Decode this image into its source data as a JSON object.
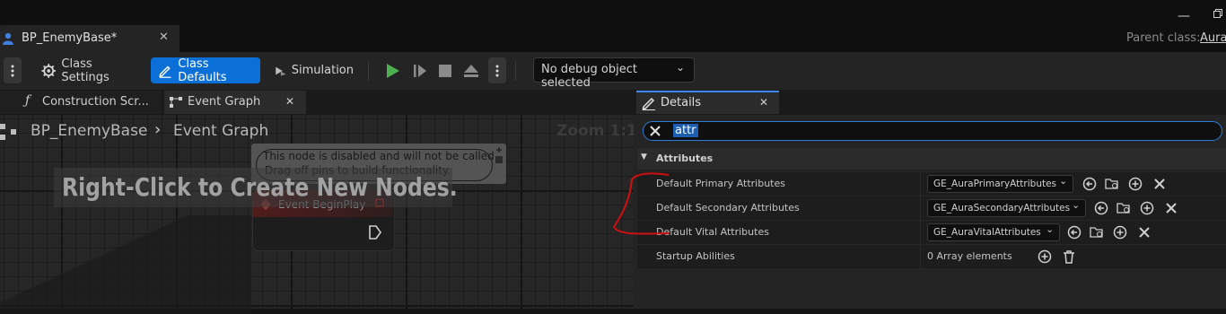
{
  "window": {
    "document_tab": "BP_EnemyBase*",
    "parent_class_label": "Parent class:",
    "parent_class_value": "Aura"
  },
  "toolbar": {
    "class_settings": "Class Settings",
    "class_defaults": "Class Defaults",
    "simulation": "Simulation",
    "debug_object": "No debug object selected"
  },
  "graph_tabs": [
    {
      "label": "Construction Scr..."
    },
    {
      "label": "Event Graph"
    }
  ],
  "graph": {
    "breadcrumb_root": "BP_EnemyBase",
    "breadcrumb_current": "Event Graph",
    "zoom": "Zoom 1:1",
    "hint": "Right-Click to Create New Nodes.",
    "node_title": "Event BeginPlay",
    "disabled_line1": "This node is disabled and will not be called.",
    "disabled_line2": "Drag off pins to build functionality."
  },
  "details": {
    "tab_label": "Details",
    "search_value": "attr",
    "category": "Attributes",
    "rows": [
      {
        "name": "Default Primary Attributes",
        "value": "GE_AuraPrimaryAttributes"
      },
      {
        "name": "Default Secondary Attributes",
        "value": "GE_AuraSecondaryAttributes"
      },
      {
        "name": "Default Vital Attributes",
        "value": "GE_AuraVitalAttributes"
      },
      {
        "name": "Startup Abilities",
        "value": "0 Array elements"
      }
    ]
  },
  "colors": {
    "accent": "#0a70d8",
    "play_green": "#4caf50",
    "annotation_red": "#d01010"
  }
}
